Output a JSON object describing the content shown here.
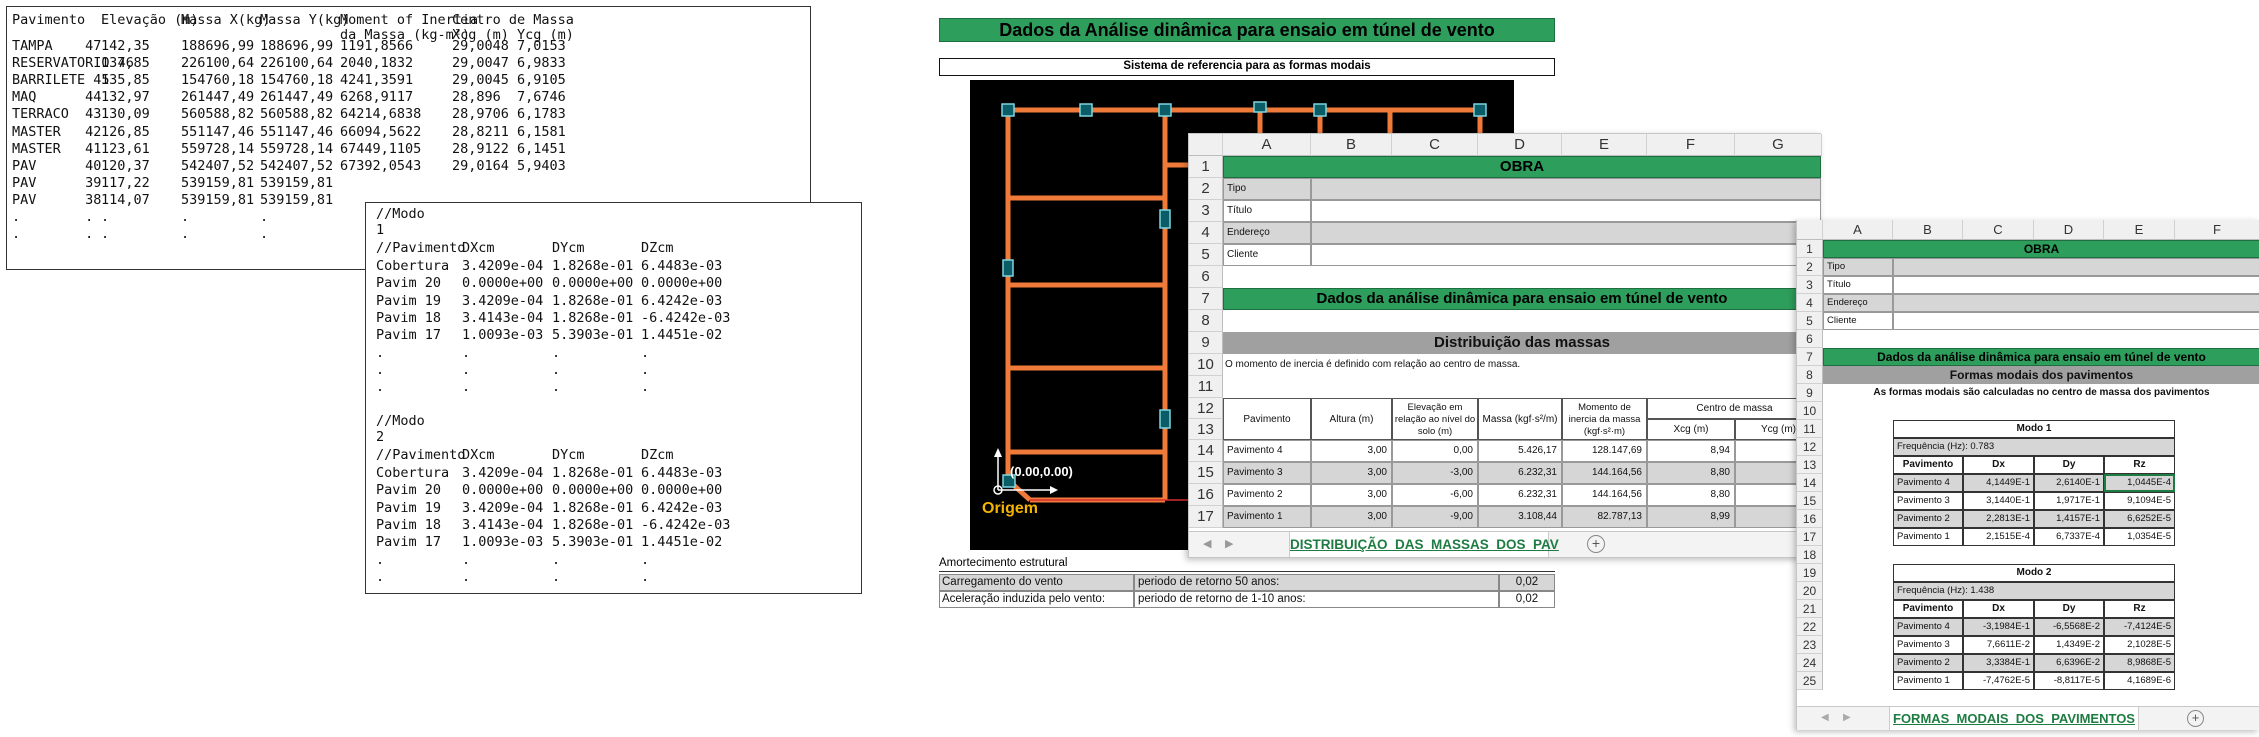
{
  "mass_table": {
    "headers": [
      "Pavimento",
      "Elevação (m)",
      "Massa X(kg)",
      "Massa Y(kg)",
      "Moment of Inertia",
      "da Massa (kg-m²)",
      "Centro de Massa",
      "Xcg (m)",
      "Ycg (m)"
    ],
    "rows": [
      [
        "TAMPA    47",
        "142,35",
        "188696,99",
        "188696,99",
        "1191,8566",
        "29,0048",
        "7,0153"
      ],
      [
        "RESERVATORIO 46",
        "137,85",
        "226100,64",
        "226100,64",
        "2040,1832",
        "29,0047",
        "6,9833"
      ],
      [
        "BARRILETE 45",
        "135,85",
        "154760,18",
        "154760,18",
        "4241,3591",
        "29,0045",
        "6,9105"
      ],
      [
        "MAQ      44",
        "132,97",
        "261447,49",
        "261447,49",
        "6268,9117",
        "28,896",
        "7,6746"
      ],
      [
        "TERRACO  43",
        "130,09",
        "560588,82",
        "560588,82",
        "64214,6838",
        "28,9706",
        "6,1783"
      ],
      [
        "MASTER   42",
        "126,85",
        "551147,46",
        "551147,46",
        "66094,5622",
        "28,8211",
        "6,1581"
      ],
      [
        "MASTER   41",
        "123,61",
        "559728,14",
        "559728,14",
        "67449,1105",
        "28,9122",
        "6,1451"
      ],
      [
        "PAV      40",
        "120,37",
        "542407,52",
        "542407,52",
        "67392,0543",
        "29,0164",
        "5,9403"
      ],
      [
        "PAV      39",
        "117,22",
        "539159,81",
        "539159,81",
        "",
        "",
        ""
      ],
      [
        "PAV      38",
        "114,07",
        "539159,81",
        "539159,81",
        "",
        "",
        ""
      ],
      [
        ".        .",
        ".",
        ".",
        ".",
        "",
        "",
        ""
      ],
      [
        ".        .",
        ".",
        ".",
        ".",
        "",
        "",
        ""
      ]
    ]
  },
  "modal_text": {
    "blocks": [
      {
        "title": "//Modo",
        "num": "1",
        "headers": [
          "//Pavimento",
          "DXcm",
          "DYcm",
          "DZcm"
        ],
        "rows": [
          [
            "Cobertura",
            "3.4209e-04",
            "1.8268e-01",
            "6.4483e-03"
          ],
          [
            "Pavim 20",
            "0.0000e+00",
            "0.0000e+00",
            "0.0000e+00"
          ],
          [
            "Pavim 19",
            "3.4209e-04",
            "1.8268e-01",
            "6.4242e-03"
          ],
          [
            "Pavim 18",
            "3.4143e-04",
            "1.8268e-01",
            "-6.4242e-03"
          ],
          [
            "Pavim 17",
            "1.0093e-03",
            "5.3903e-01",
            "1.4451e-02"
          ],
          [
            ".",
            ".",
            ".",
            "."
          ],
          [
            ".",
            ".",
            ".",
            "."
          ],
          [
            ".",
            ".",
            ".",
            "."
          ]
        ]
      },
      {
        "title": "//Modo",
        "num": "2",
        "headers": [
          "//Pavimento",
          "DXcm",
          "DYcm",
          "DZcm"
        ],
        "rows": [
          [
            "Cobertura",
            "3.4209e-04",
            "1.8268e-01",
            "6.4483e-03"
          ],
          [
            "Pavim 20",
            "0.0000e+00",
            "0.0000e+00",
            "0.0000e+00"
          ],
          [
            "Pavim 19",
            "3.4209e-04",
            "1.8268e-01",
            "6.4242e-03"
          ],
          [
            "Pavim 18",
            "3.4143e-04",
            "1.8268e-01",
            "-6.4242e-03"
          ],
          [
            "Pavim 17",
            "1.0093e-03",
            "5.3903e-01",
            "1.4451e-02"
          ],
          [
            ".",
            ".",
            ".",
            "."
          ],
          [
            ".",
            ".",
            ".",
            "."
          ]
        ]
      }
    ]
  },
  "report": {
    "title": "Dados da Análise dinâmica para ensaio em túnel de vento",
    "subtitle": "Sistema de referencia para as formas modais",
    "origin_label": "Origem",
    "origin_coords": "(0.00,0.00)",
    "amortecimento": "Amortecimento estrutural",
    "rows": [
      {
        "label": "Carregamento do vento",
        "desc": "periodo de retorno 50 anos:",
        "value": "0,02"
      },
      {
        "label": "Aceleração induzida pelo vento:",
        "desc": "periodo de retorno de 1-10 anos:",
        "value": "0,02"
      }
    ]
  },
  "sheet_distribuicao": {
    "columns": [
      "A",
      "B",
      "C",
      "D",
      "E",
      "F",
      "G"
    ],
    "row_numbers": [
      "1",
      "2",
      "3",
      "4",
      "5",
      "6",
      "7",
      "8",
      "9",
      "10",
      "11",
      "12",
      "13",
      "14",
      "15",
      "16",
      "17"
    ],
    "obra": "OBRA",
    "info_labels": [
      "Tipo",
      "Título",
      "Endereço",
      "Cliente"
    ],
    "section_title": "Dados da análise dinâmica para ensaio em túnel de vento",
    "dist_title": "Distribuição das massas",
    "note": "O momento de inercia é definido com relação ao centro de massa.",
    "table_headers": [
      "Pavimento",
      "Altura (m)",
      "Elevação em relação ao nível do solo (m)",
      "Massa (kgf·s²/m)",
      "Momento de inercia da massa (kgf·s²·m)",
      "Centro de massa",
      "Xcg (m)",
      "Ycg (m)"
    ],
    "rows": [
      [
        "Pavimento 4",
        "3,00",
        "0,00",
        "5.426,17",
        "128.147,69",
        "8,94",
        ""
      ],
      [
        "Pavimento 3",
        "3,00",
        "-3,00",
        "6.232,31",
        "144.164,56",
        "8,80",
        ""
      ],
      [
        "Pavimento 2",
        "3,00",
        "-6,00",
        "6.232,31",
        "144.164,56",
        "8,80",
        ""
      ],
      [
        "Pavimento 1",
        "3,00",
        "-9,00",
        "3.108,44",
        "82.787,13",
        "8,99",
        ""
      ]
    ],
    "tab_name": "DISTRIBUIÇÃO_DAS_MASSAS_DOS_PAV",
    "add_sheet": "+"
  },
  "sheet_formas": {
    "columns": [
      "A",
      "B",
      "C",
      "D",
      "E",
      "F"
    ],
    "row_numbers": [
      "1",
      "2",
      "3",
      "4",
      "5",
      "6",
      "7",
      "8",
      "9",
      "10",
      "11",
      "12",
      "13",
      "14",
      "15",
      "16",
      "17",
      "18",
      "19",
      "20",
      "21",
      "22",
      "23",
      "24",
      "25"
    ],
    "obra": "OBRA",
    "info_labels": [
      "Tipo",
      "Título",
      "Endereço",
      "Cliente"
    ],
    "section_title": "Dados da análise dinâmica para ensaio em túnel de vento",
    "formas_title": "Formas modais dos pavimentos",
    "note": "As formas modais são calculadas no centro de massa dos pavimentos",
    "modes": [
      {
        "title": "Modo 1",
        "freq": "Frequência (Hz): 0.783",
        "headers": [
          "Pavimento",
          "Dx",
          "Dy",
          "Rz"
        ],
        "rows": [
          [
            "Pavimento 4",
            "4,1449E-1",
            "2,6140E-1",
            "1,0445E-4"
          ],
          [
            "Pavimento 3",
            "3,1440E-1",
            "1,9717E-1",
            "9,1094E-5"
          ],
          [
            "Pavimento 2",
            "2,2813E-1",
            "1,4157E-1",
            "6,6252E-5"
          ],
          [
            "Pavimento 1",
            "2,1515E-4",
            "6,7337E-4",
            "1,0354E-5"
          ]
        ]
      },
      {
        "title": "Modo 2",
        "freq": "Frequência (Hz): 1.438",
        "headers": [
          "Pavimento",
          "Dx",
          "Dy",
          "Rz"
        ],
        "rows": [
          [
            "Pavimento 4",
            "-3,1984E-1",
            "-6,5568E-2",
            "-7,4124E-5"
          ],
          [
            "Pavimento 3",
            "7,6611E-2",
            "1,4349E-2",
            "2,1028E-5"
          ],
          [
            "Pavimento 2",
            "3,3384E-1",
            "6,6396E-2",
            "8,9868E-5"
          ],
          [
            "Pavimento 1",
            "-7,4762E-5",
            "-8,8117E-5",
            "4,1689E-6"
          ]
        ]
      }
    ],
    "tab_name": "FORMAS_MODAIS_DOS_PAVIMENTOS",
    "add_sheet": "+"
  }
}
